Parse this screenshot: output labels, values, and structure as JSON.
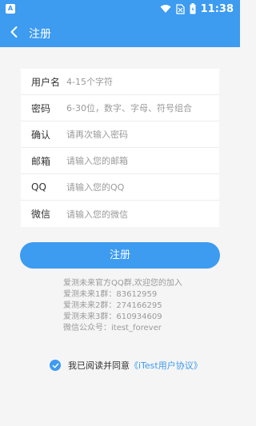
{
  "status_bar": {
    "left_icon_letter": "A",
    "time": "11:38",
    "icons": [
      "wifi-icon",
      "no-sim-icon",
      "battery-icon"
    ]
  },
  "app_bar": {
    "back_icon": "chevron-left-icon",
    "title": "注册"
  },
  "form": {
    "fields": [
      {
        "label": "用户名",
        "placeholder": "4-15个字符"
      },
      {
        "label": "密码",
        "placeholder": "6-30位，数字、字母、符号组合"
      },
      {
        "label": "确认",
        "placeholder": "请再次输入密码"
      },
      {
        "label": "邮箱",
        "placeholder": "请输入您的邮箱"
      },
      {
        "label": "QQ",
        "placeholder": "请输入您的QQ"
      },
      {
        "label": "微信",
        "placeholder": "请输入您的微信"
      }
    ]
  },
  "submit_label": "注册",
  "info": {
    "lines": [
      "爱测未来官方QQ群,欢迎您的加入",
      "爱测未来1群：83612959",
      "爱测未来2群：274166295",
      "爱测未来3群：610934609",
      "微信公众号：itest_forever"
    ]
  },
  "agreement": {
    "text": "我已阅读并同意",
    "link": "《iTest用户协议》",
    "checked": true
  },
  "colors": {
    "accent": "#3d9bf0",
    "background": "#f5f5f5"
  }
}
